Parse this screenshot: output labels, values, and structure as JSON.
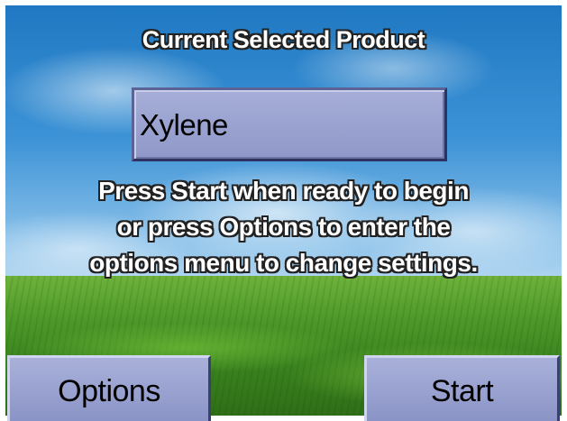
{
  "screen": {
    "title": "Current Selected Product",
    "product": "Xylene",
    "message_lines": [
      "Press Start when ready to begin",
      "or press Options to enter the",
      "options menu to change settings."
    ]
  },
  "buttons": {
    "options_label": "Options",
    "start_label": "Start"
  },
  "colors": {
    "button_face": "#9aa2d0",
    "text_fill": "#ffffff",
    "text_outline": "#222222",
    "sky": "#2f86c8",
    "grass": "#4f9a2a"
  }
}
